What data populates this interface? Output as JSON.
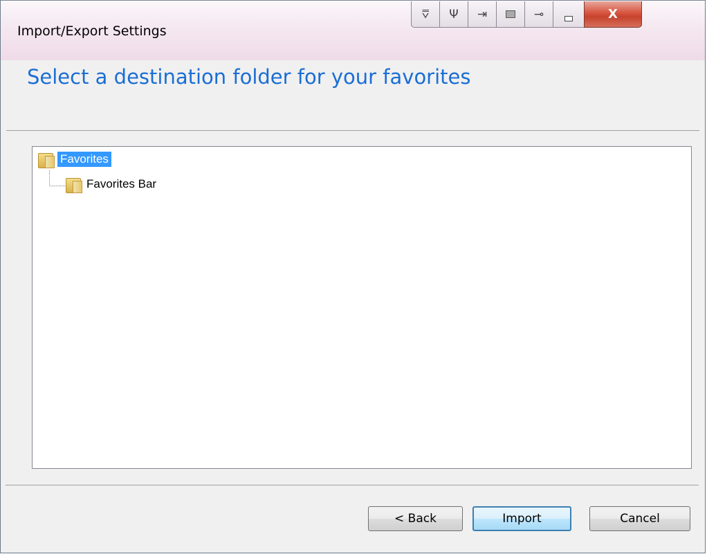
{
  "window": {
    "title": "Import/Export Settings",
    "caption_buttons": [
      {
        "name": "filter-icon",
        "glyph": "⩢"
      },
      {
        "name": "plug-icon",
        "glyph": "Ψ"
      },
      {
        "name": "enter-icon",
        "glyph": "⇥"
      },
      {
        "name": "keyboard-icon",
        "glyph": ""
      },
      {
        "name": "connector-icon",
        "glyph": "⊸"
      }
    ],
    "close_glyph": "X"
  },
  "header": {
    "heading": "Select a destination folder for your favorites"
  },
  "tree": {
    "nodes": [
      {
        "label": "Favorites",
        "selected": true
      },
      {
        "label": "Favorites Bar",
        "selected": false
      }
    ]
  },
  "buttons": {
    "back": "< Back",
    "import": "Import",
    "cancel": "Cancel"
  },
  "colors": {
    "heading": "#1a6ed4",
    "selection": "#3399ff",
    "close_button": "#c7432d"
  }
}
